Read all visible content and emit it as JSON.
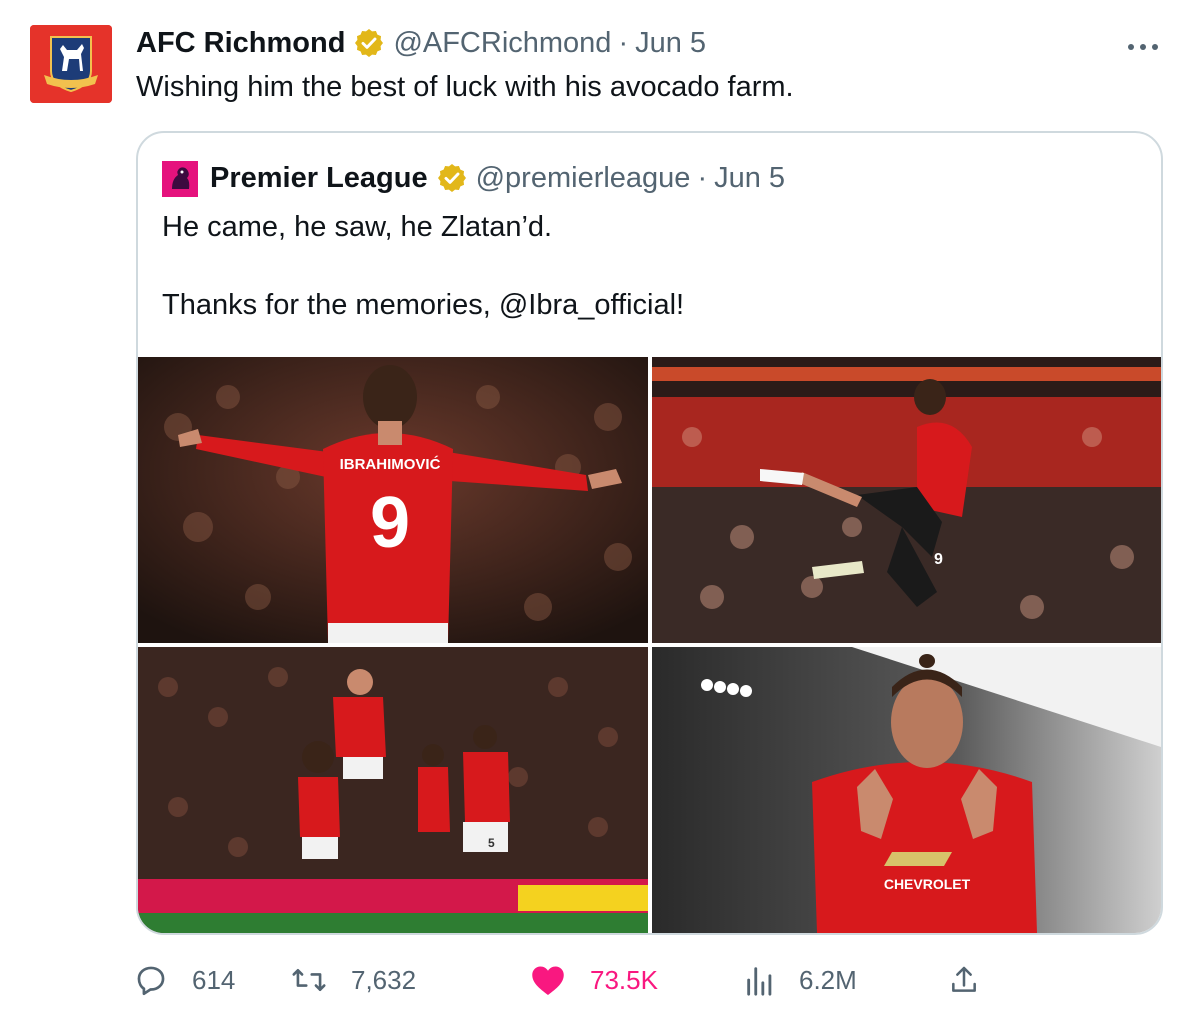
{
  "tweet": {
    "author_name": "AFC Richmond",
    "author_handle": "@AFCRichmond",
    "separator": "·",
    "date": "Jun 5",
    "text": "Wishing him the best of luck with his avocado farm.",
    "more_icon": "more-horizontal-icon"
  },
  "quoted_tweet": {
    "author_name": "Premier League",
    "author_handle": "@premierleague",
    "separator": "·",
    "date": "Jun 5",
    "text_line1": "He came, he saw, he Zlatan’d.",
    "text_line2": "Thanks for the memories, @Ibra_official!",
    "photos": [
      {
        "jersey_name": "IBRAHIMOVIĆ",
        "jersey_number": "9"
      },
      {
        "jersey_number": "9"
      },
      {
        "jersey_number": "5"
      },
      {
        "sponsor": "CHEVROLET"
      }
    ]
  },
  "actions": {
    "replies": "614",
    "retweets": "7,632",
    "likes": "73.5K",
    "views": "6.2M"
  },
  "colors": {
    "verified_gold": "#e2b719",
    "like_pink": "#f91880",
    "secondary_text": "#536471",
    "border": "#cfd9de",
    "richmond_red": "#e5332a",
    "premier_pink": "#e5127d"
  }
}
